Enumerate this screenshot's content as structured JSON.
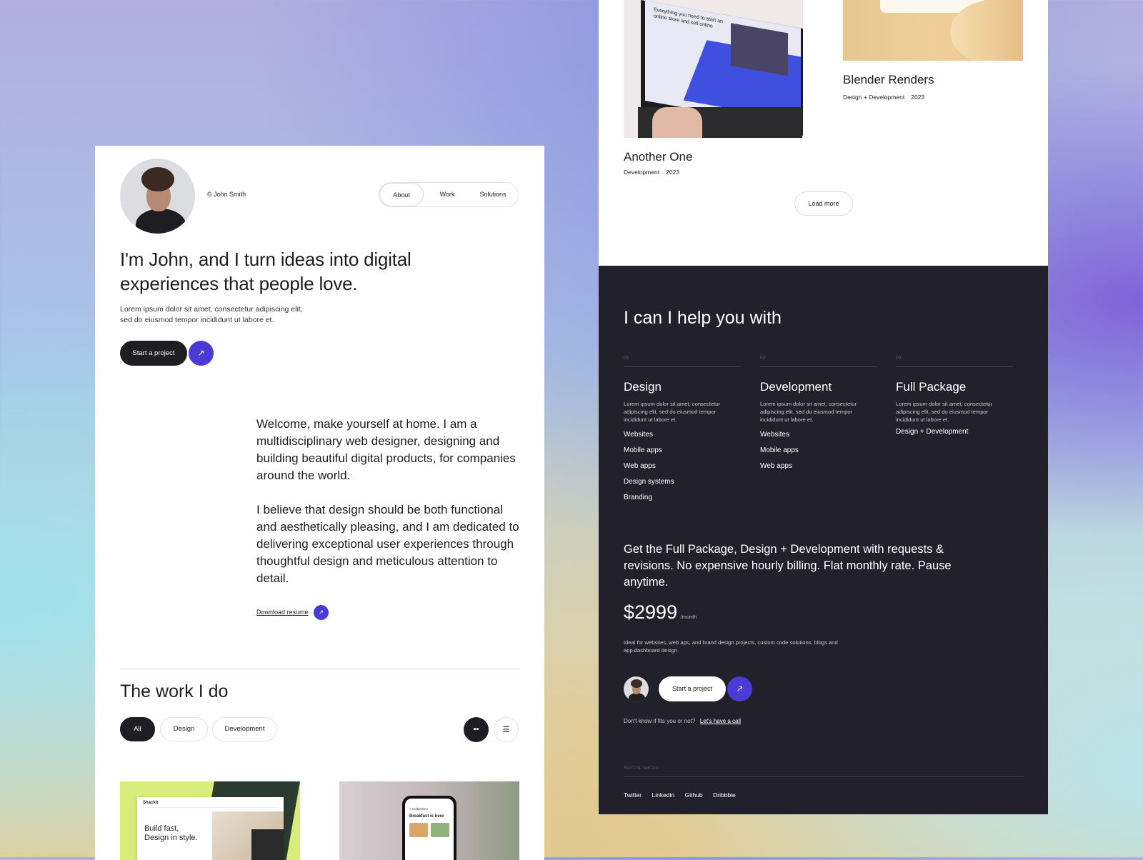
{
  "left": {
    "copyright": "© John Smith",
    "nav": [
      {
        "label": "About"
      },
      {
        "label": "Work"
      },
      {
        "label": "Solutions"
      }
    ],
    "hero": {
      "title_line1": "I'm John, and I turn ideas into digital",
      "title_line2": "experiences that people love.",
      "sub_line1": "Lorem ipsum dolor sit amet, consectetur adipiscing elit,",
      "sub_line2": "sed do eiusmod tempor incididunt ut labore et.",
      "cta": "Start a project",
      "cta_icon": "arrow-up-right-icon"
    },
    "about": {
      "p1": "Welcome, make yourself at home. I am a multidisciplinary web designer, designing and building beautiful digital products, for companies around the world.",
      "p2": "I believe that design should be both functional and aesthetically pleasing, and I am dedicated to delivering exceptional user experiences through thoughtful design and meticulous attention to detail.",
      "download": "Download resume"
    },
    "work": {
      "title": "The work I do",
      "filters": [
        "All",
        "Design",
        "Development"
      ],
      "view_icons": [
        "grid-icon",
        "list-icon"
      ],
      "thumb1": {
        "brand": "Shackit",
        "headline_line1": "Build fast,",
        "headline_line2": "Design in style."
      },
      "thumb2": {
        "header": "< Collections",
        "title": "Breakfast is here"
      }
    }
  },
  "right_top": {
    "card1": {
      "title": "Another One",
      "category": "Development",
      "year": "2023",
      "screen_text": "Everything you need to start an online store and sell online"
    },
    "card2": {
      "title": "Blender Renders",
      "category": "Design + Development",
      "year": "2023"
    },
    "load_more": "Load more"
  },
  "services": {
    "title": "I can I help you with",
    "columns": [
      {
        "num": "01",
        "title": "Design",
        "desc": "Lorem ipsum dolor sit amet, consectetur adipiscing elit, sed do eiusmod tempor incididunt ut labore et.",
        "items": [
          "Websites",
          "Mobile apps",
          "Web apps",
          "Design systems",
          "Branding"
        ]
      },
      {
        "num": "02",
        "title": "Development",
        "desc": "Lorem ipsum dolor sit amet, consectetur adipiscing elit, sed do eiusmod tempor incididunt ut labore et.",
        "items": [
          "Websites",
          "Mobile apps",
          "Web apps"
        ]
      },
      {
        "num": "03",
        "title": "Full Package",
        "desc": "Lorem ipsum dolor sit amet, consectetur adipiscing elit, sed do eiusmod tempor incididunt ut labore et.",
        "items": [
          "Design + Development"
        ]
      }
    ],
    "pitch": "Get the Full Package, Design + Development with requests & revisions. No expensive hourly billing. Flat monthly rate. Pause anytime.",
    "price": "$2999",
    "per": "/month",
    "ideal": "Ideal for websites, web aps, and brand design projects, custom code solutions, blogs and app dashboard design.",
    "cta": "Start a project",
    "note": "Don't know if fits you or not?",
    "note_link": "Let's have a call",
    "social_label": "SOCIAL MEDIA",
    "social": [
      "Twitter",
      "Linkedin",
      "Github",
      "Dribbble"
    ]
  },
  "colors": {
    "accent": "#4b3bd6",
    "dark": "#22212b",
    "ink": "#1d1d21"
  }
}
